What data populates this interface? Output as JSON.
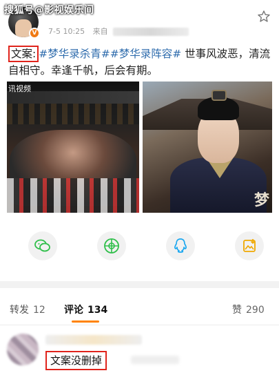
{
  "watermark": "搜狐号@影视娱乐间",
  "post": {
    "time": "7-5 10:25",
    "source_prefix": "来自",
    "label": "文案:",
    "tags": [
      "#梦华录杀青#",
      "#梦华录阵容#"
    ],
    "body": " 世事风波恶，清流自相守。幸逢千帆，后会有期。"
  },
  "images": {
    "left_watermark": "讯视频",
    "right_glyph": "梦"
  },
  "share": [
    "wechat-icon",
    "moments-icon",
    "qq-icon",
    "save-image-icon"
  ],
  "tabs": [
    {
      "label": "转发",
      "count": "12"
    },
    {
      "label": "评论",
      "count": "134"
    },
    {
      "label": "赞",
      "count": "290"
    }
  ],
  "comment": {
    "text": "文案没删掉"
  },
  "colors": {
    "highlight": "#e0231b",
    "tag": "#2f6cad",
    "tab_accent": "#ff8200",
    "verified": "#f07a14"
  }
}
